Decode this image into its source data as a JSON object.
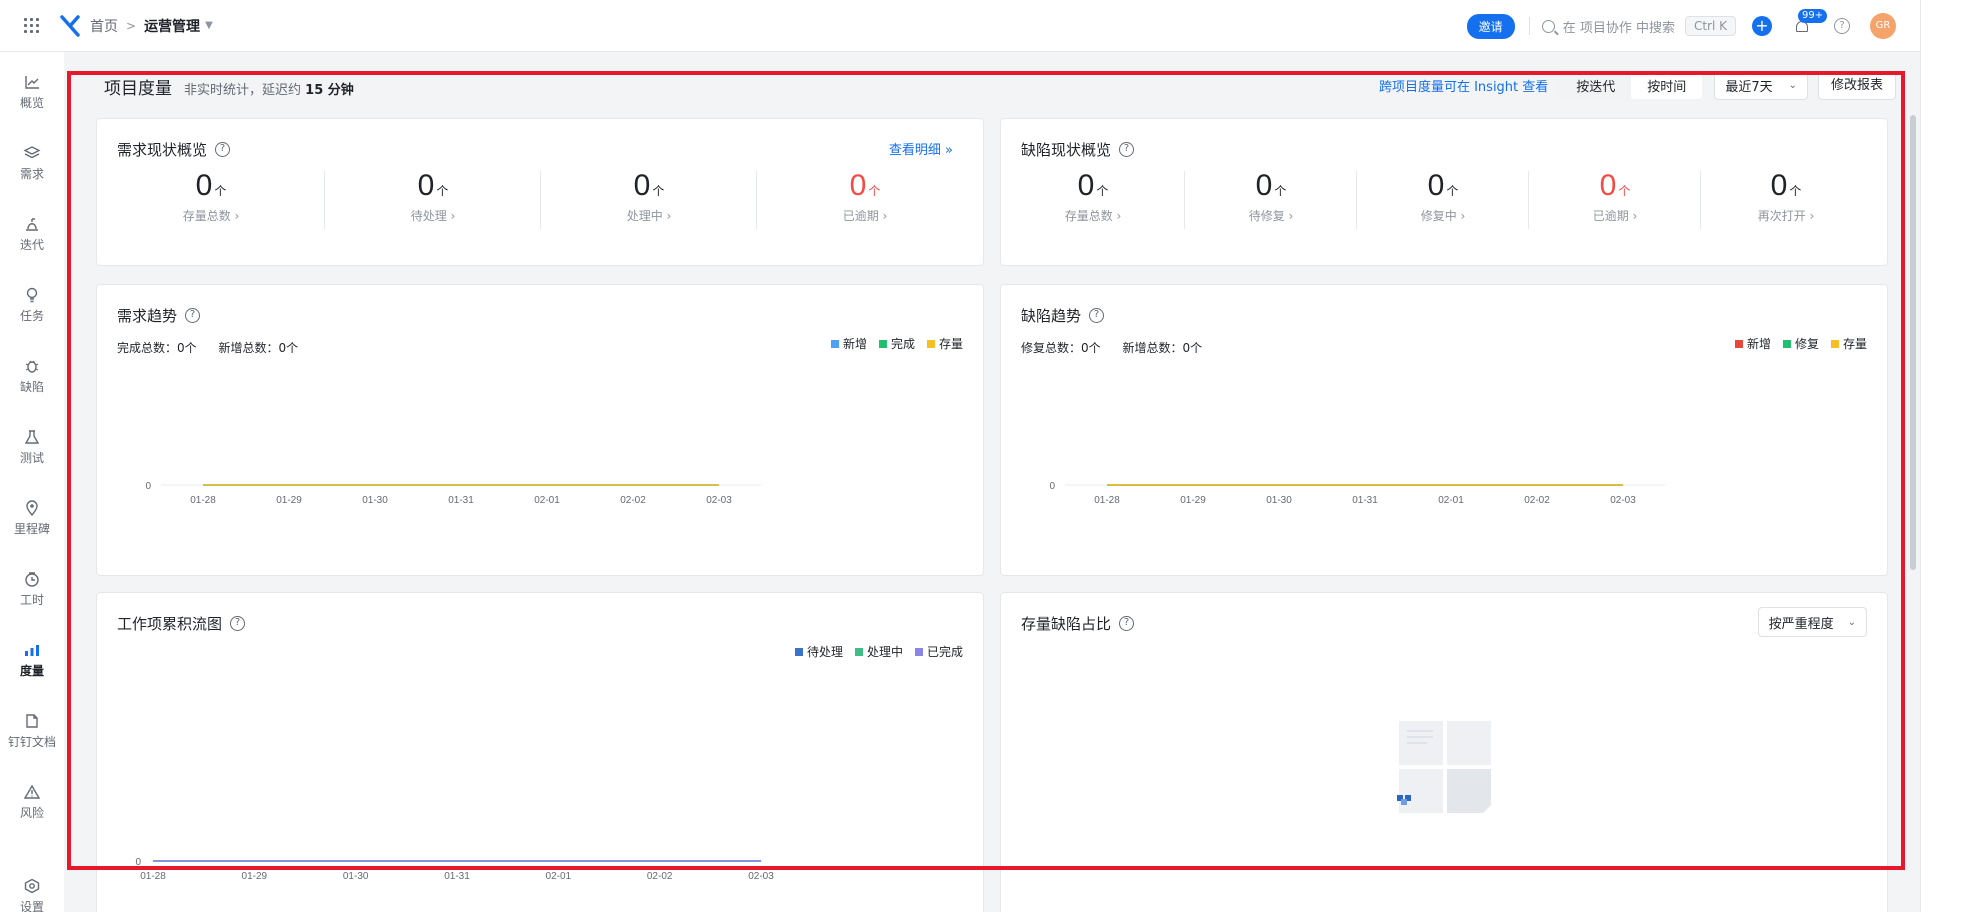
{
  "topbar": {
    "home": "首页",
    "current": "运营管理",
    "invite": "邀请",
    "search_placeholder": "在 项目协作 中搜索",
    "shortcut": "Ctrl K",
    "notif_badge": "99+",
    "avatar": "GR"
  },
  "sidebar": {
    "items": [
      {
        "label": "概览",
        "icon": "line-chart-icon"
      },
      {
        "label": "需求",
        "icon": "layers-icon"
      },
      {
        "label": "迭代",
        "icon": "iteration-icon"
      },
      {
        "label": "任务",
        "icon": "bulb-icon"
      },
      {
        "label": "缺陷",
        "icon": "bug-icon"
      },
      {
        "label": "测试",
        "icon": "flask-icon"
      },
      {
        "label": "里程碑",
        "icon": "pin-icon"
      },
      {
        "label": "工时",
        "icon": "clock-icon"
      },
      {
        "label": "度量",
        "icon": "bar-chart-icon",
        "active": true
      },
      {
        "label": "钉钉文档",
        "icon": "doc-icon"
      },
      {
        "label": "风险",
        "icon": "warning-icon"
      },
      {
        "label": "设置",
        "icon": "settings-icon"
      }
    ]
  },
  "header": {
    "title": "项目度量",
    "subtitle_prefix": "非实时统计，延迟约",
    "subtitle_value": "15 分钟",
    "insight_link": "跨项目度量可在 Insight 查看",
    "seg_iteration": "按迭代",
    "seg_time": "按时间",
    "range": "最近7天",
    "edit_report": "修改报表"
  },
  "req_overview": {
    "title": "需求现状概览",
    "detail": "查看明细 »",
    "unit": "个",
    "stats": [
      {
        "value": "0",
        "label": "存量总数 ›"
      },
      {
        "value": "0",
        "label": "待处理 ›"
      },
      {
        "value": "0",
        "label": "处理中 ›"
      },
      {
        "value": "0",
        "label": "已逾期 ›",
        "red": true
      }
    ]
  },
  "bug_overview": {
    "title": "缺陷现状概览",
    "unit": "个",
    "stats": [
      {
        "value": "0",
        "label": "存量总数 ›"
      },
      {
        "value": "0",
        "label": "待修复 ›"
      },
      {
        "value": "0",
        "label": "修复中 ›"
      },
      {
        "value": "0",
        "label": "已逾期 ›",
        "red": true
      },
      {
        "value": "0",
        "label": "再次打开 ›"
      }
    ]
  },
  "req_trend": {
    "title": "需求趋势",
    "done_total": "完成总数：0个",
    "new_total": "新增总数：0个",
    "legend": [
      "新增",
      "完成",
      "存量"
    ]
  },
  "bug_trend": {
    "title": "缺陷趋势",
    "fixed_total": "修复总数：0个",
    "new_total": "新增总数：0个",
    "legend": [
      "新增",
      "修复",
      "存量"
    ]
  },
  "cfd": {
    "title": "工作项累积流图",
    "legend": [
      "待处理",
      "处理中",
      "已完成"
    ]
  },
  "bug_ratio": {
    "title": "存量缺陷占比",
    "select": "按严重程度"
  },
  "colors": {
    "accent": "#1570ef",
    "red": "#f54a45",
    "new_blue": "#4ea1f3",
    "done_green": "#1fbf6f",
    "stock_yellow": "#f5c026",
    "bug_red": "#e8483b",
    "cfd_blue": "#3b73c9",
    "cfd_green": "#3fbf85",
    "cfd_purple": "#8a86e6"
  },
  "chart_data": [
    {
      "type": "line",
      "x": [
        "01-28",
        "01-29",
        "01-30",
        "01-31",
        "02-01",
        "02-02",
        "02-03"
      ],
      "series": [
        {
          "name": "新增",
          "values": [
            0,
            0,
            0,
            0,
            0,
            0,
            0
          ]
        },
        {
          "name": "完成",
          "values": [
            0,
            0,
            0,
            0,
            0,
            0,
            0
          ]
        },
        {
          "name": "存量",
          "values": [
            0,
            0,
            0,
            0,
            0,
            0,
            0
          ]
        }
      ],
      "yticks": [
        "0"
      ]
    },
    {
      "type": "line",
      "x": [
        "01-28",
        "01-29",
        "01-30",
        "01-31",
        "02-01",
        "02-02",
        "02-03"
      ],
      "series": [
        {
          "name": "新增",
          "values": [
            0,
            0,
            0,
            0,
            0,
            0,
            0
          ]
        },
        {
          "name": "修复",
          "values": [
            0,
            0,
            0,
            0,
            0,
            0,
            0
          ]
        },
        {
          "name": "存量",
          "values": [
            0,
            0,
            0,
            0,
            0,
            0,
            0
          ]
        }
      ],
      "yticks": [
        "0"
      ]
    },
    {
      "type": "area",
      "x": [
        "01-28",
        "01-29",
        "01-30",
        "01-31",
        "02-01",
        "02-02",
        "02-03"
      ],
      "series": [
        {
          "name": "待处理",
          "values": [
            0,
            0,
            0,
            0,
            0,
            0,
            0
          ]
        },
        {
          "name": "处理中",
          "values": [
            0,
            0,
            0,
            0,
            0,
            0,
            0
          ]
        },
        {
          "name": "已完成",
          "values": [
            0,
            0,
            0,
            0,
            0,
            0,
            0
          ]
        }
      ],
      "yticks": [
        "0"
      ]
    }
  ]
}
